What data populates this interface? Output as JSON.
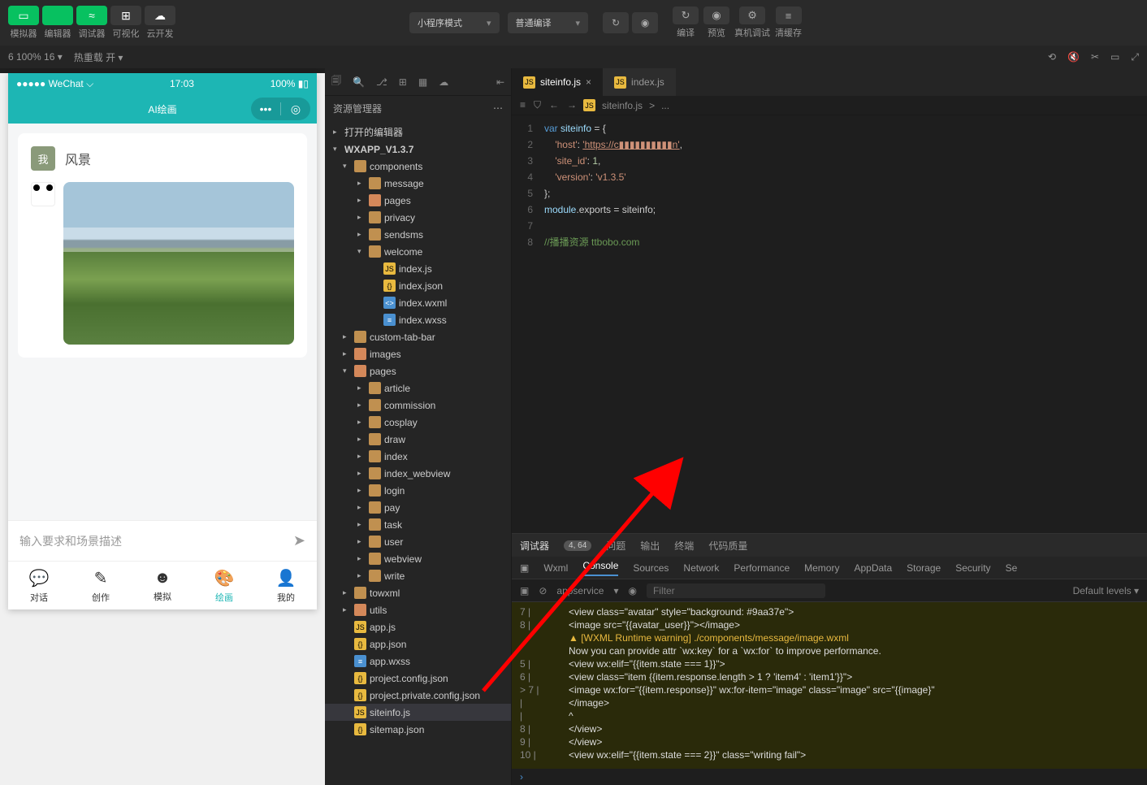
{
  "toolbar": {
    "buttons": [
      {
        "label": "模拟器",
        "icon": "▭",
        "color": "green"
      },
      {
        "label": "编辑器",
        "icon": "</>",
        "color": "green"
      },
      {
        "label": "调试器",
        "icon": "≈",
        "color": "green"
      },
      {
        "label": "可视化",
        "icon": "⊞",
        "color": "dark"
      },
      {
        "label": "云开发",
        "icon": "☁",
        "color": "dark"
      }
    ],
    "mode_dropdown": "小程序模式",
    "compile_dropdown": "普通编译",
    "right_items": [
      {
        "label": "编译",
        "icon": "↻"
      },
      {
        "label": "预览",
        "icon": "◉"
      },
      {
        "label": "真机调试",
        "icon": "⚙"
      },
      {
        "label": "清缓存",
        "icon": "≡"
      }
    ]
  },
  "second_bar": {
    "zoom": "6 100% 16 ▾",
    "hot_reload": "热重载 开 ▾"
  },
  "simulator": {
    "status": {
      "left": "●●●●● WeChat",
      "wifi": "⌵",
      "time": "17:03",
      "battery": "100%"
    },
    "nav_title": "AI绘画",
    "card_badge": "我",
    "card_title": "风景",
    "input_placeholder": "输入要求和场景描述",
    "tabs": [
      {
        "icon": "💬",
        "label": "对话"
      },
      {
        "icon": "✎",
        "label": "创作"
      },
      {
        "icon": "☻",
        "label": "模拟"
      },
      {
        "icon": "🎨",
        "label": "绘画"
      },
      {
        "icon": "👤",
        "label": "我的"
      }
    ],
    "active_tab": 3
  },
  "explorer": {
    "title": "资源管理器",
    "sections": {
      "open_editors": "打开的编辑器",
      "project": "WXAPP_V1.3.7"
    },
    "tree": [
      {
        "type": "folder",
        "name": "components",
        "open": true,
        "lvl": 1,
        "children": [
          {
            "type": "folder",
            "name": "message",
            "lvl": 2
          },
          {
            "type": "folder",
            "name": "pages",
            "lvl": 2,
            "color": "fold2"
          },
          {
            "type": "folder",
            "name": "privacy",
            "lvl": 2
          },
          {
            "type": "folder",
            "name": "sendsms",
            "lvl": 2
          },
          {
            "type": "folder",
            "name": "welcome",
            "open": true,
            "lvl": 2,
            "children": [
              {
                "type": "js",
                "name": "index.js",
                "lvl": 3
              },
              {
                "type": "json",
                "name": "index.json",
                "lvl": 3
              },
              {
                "type": "wxml",
                "name": "index.wxml",
                "lvl": 3
              },
              {
                "type": "wxss",
                "name": "index.wxss",
                "lvl": 3
              }
            ]
          }
        ]
      },
      {
        "type": "folder",
        "name": "custom-tab-bar",
        "lvl": 1
      },
      {
        "type": "folder",
        "name": "images",
        "lvl": 1,
        "color": "fold2"
      },
      {
        "type": "folder",
        "name": "pages",
        "open": true,
        "lvl": 1,
        "color": "fold2",
        "children": [
          {
            "type": "folder",
            "name": "article",
            "lvl": 2
          },
          {
            "type": "folder",
            "name": "commission",
            "lvl": 2
          },
          {
            "type": "folder",
            "name": "cosplay",
            "lvl": 2
          },
          {
            "type": "folder",
            "name": "draw",
            "lvl": 2
          },
          {
            "type": "folder",
            "name": "index",
            "lvl": 2
          },
          {
            "type": "folder",
            "name": "index_webview",
            "lvl": 2
          },
          {
            "type": "folder",
            "name": "login",
            "lvl": 2
          },
          {
            "type": "folder",
            "name": "pay",
            "lvl": 2
          },
          {
            "type": "folder",
            "name": "task",
            "lvl": 2
          },
          {
            "type": "folder",
            "name": "user",
            "lvl": 2
          },
          {
            "type": "folder",
            "name": "webview",
            "lvl": 2
          },
          {
            "type": "folder",
            "name": "write",
            "lvl": 2
          }
        ]
      },
      {
        "type": "folder",
        "name": "towxml",
        "lvl": 1
      },
      {
        "type": "folder",
        "name": "utils",
        "lvl": 1,
        "color": "fold2"
      },
      {
        "type": "js",
        "name": "app.js",
        "lvl": 1
      },
      {
        "type": "json",
        "name": "app.json",
        "lvl": 1
      },
      {
        "type": "wxss",
        "name": "app.wxss",
        "lvl": 1
      },
      {
        "type": "json",
        "name": "project.config.json",
        "lvl": 1
      },
      {
        "type": "json",
        "name": "project.private.config.json",
        "lvl": 1
      },
      {
        "type": "js",
        "name": "siteinfo.js",
        "lvl": 1,
        "selected": true
      },
      {
        "type": "json",
        "name": "sitemap.json",
        "lvl": 1
      }
    ]
  },
  "editor": {
    "tabs": [
      {
        "name": "siteinfo.js",
        "active": true,
        "icon": "JS"
      },
      {
        "name": "index.js",
        "active": false,
        "icon": "JS"
      }
    ],
    "breadcrumb": [
      "siteinfo.js",
      ">",
      "..."
    ],
    "code": [
      {
        "n": 1,
        "html": "<span class='kw'>var</span> <span class='prop'>siteinfo</span> <span class='pn'>=</span> <span class='pn'>{</span>"
      },
      {
        "n": 2,
        "html": "    <span class='str'>'host'</span><span class='pn'>:</span> <span class='str-u'>'https://c▮▮▮▮▮▮▮▮▮▮n'</span><span class='pn'>,</span>"
      },
      {
        "n": 3,
        "html": "    <span class='str'>'site_id'</span><span class='pn'>:</span> <span class='num'>1</span><span class='pn'>,</span>"
      },
      {
        "n": 4,
        "html": "    <span class='str'>'version'</span><span class='pn'>:</span> <span class='str'>'v1.3.5'</span>"
      },
      {
        "n": 5,
        "html": "<span class='pn'>};</span>"
      },
      {
        "n": 6,
        "html": "<span class='prop'>module</span><span class='pn'>.</span>exports <span class='pn'>=</span> siteinfo<span class='pn'>;</span>"
      },
      {
        "n": 7,
        "html": ""
      },
      {
        "n": 8,
        "html": "<span class='comment'>//播播资源 ttbobo.com</span>"
      }
    ]
  },
  "debug": {
    "tabs1": [
      {
        "label": "调试器",
        "active": true
      },
      {
        "label": "4, 64",
        "badge": true
      },
      {
        "label": "问题"
      },
      {
        "label": "输出"
      },
      {
        "label": "终端"
      },
      {
        "label": "代码质量"
      }
    ],
    "tabs2": [
      "Wxml",
      "Console",
      "Sources",
      "Network",
      "Performance",
      "Memory",
      "AppData",
      "Storage",
      "Security",
      "Se"
    ],
    "tabs2_active": 1,
    "context": "appservice",
    "filter_placeholder": "Filter",
    "levels": "Default levels ▾",
    "console_lines": [
      {
        "g": "  7 |",
        "t": "        <view class=\"avatar\" style=\"background: #9aa37e\">"
      },
      {
        "g": "  8 |",
        "t": "          <image src=\"{{avatar_user}}\"></image>"
      },
      {
        "g": "",
        "warn": true,
        "t": "▲ [WXML Runtime warning] ./components/message/image.wxml"
      },
      {
        "g": "",
        "t": " Now you can provide attr `wx:key` for a `wx:for` to improve performance."
      },
      {
        "g": "  5 |",
        "t": "    <view wx:elif=\"{{item.state === 1}}\">"
      },
      {
        "g": "  6 |",
        "t": "      <view class=\"item {{item.response.length > 1 ? 'item4' : 'item1'}}\">"
      },
      {
        "g": "> 7 |",
        "t": "        <image wx:for=\"{{item.response}}\" wx:for-item=\"image\" class=\"image\" src=\"{{image}\""
      },
      {
        "g": "    |",
        "t": "</image>"
      },
      {
        "g": "    |",
        "t": "         ^"
      },
      {
        "g": "  8 |",
        "t": "      </view>"
      },
      {
        "g": "  9 |",
        "t": "    </view>"
      },
      {
        "g": " 10 |",
        "t": "    <view wx:elif=\"{{item.state === 2}}\" class=\"writing fail\">"
      }
    ]
  }
}
